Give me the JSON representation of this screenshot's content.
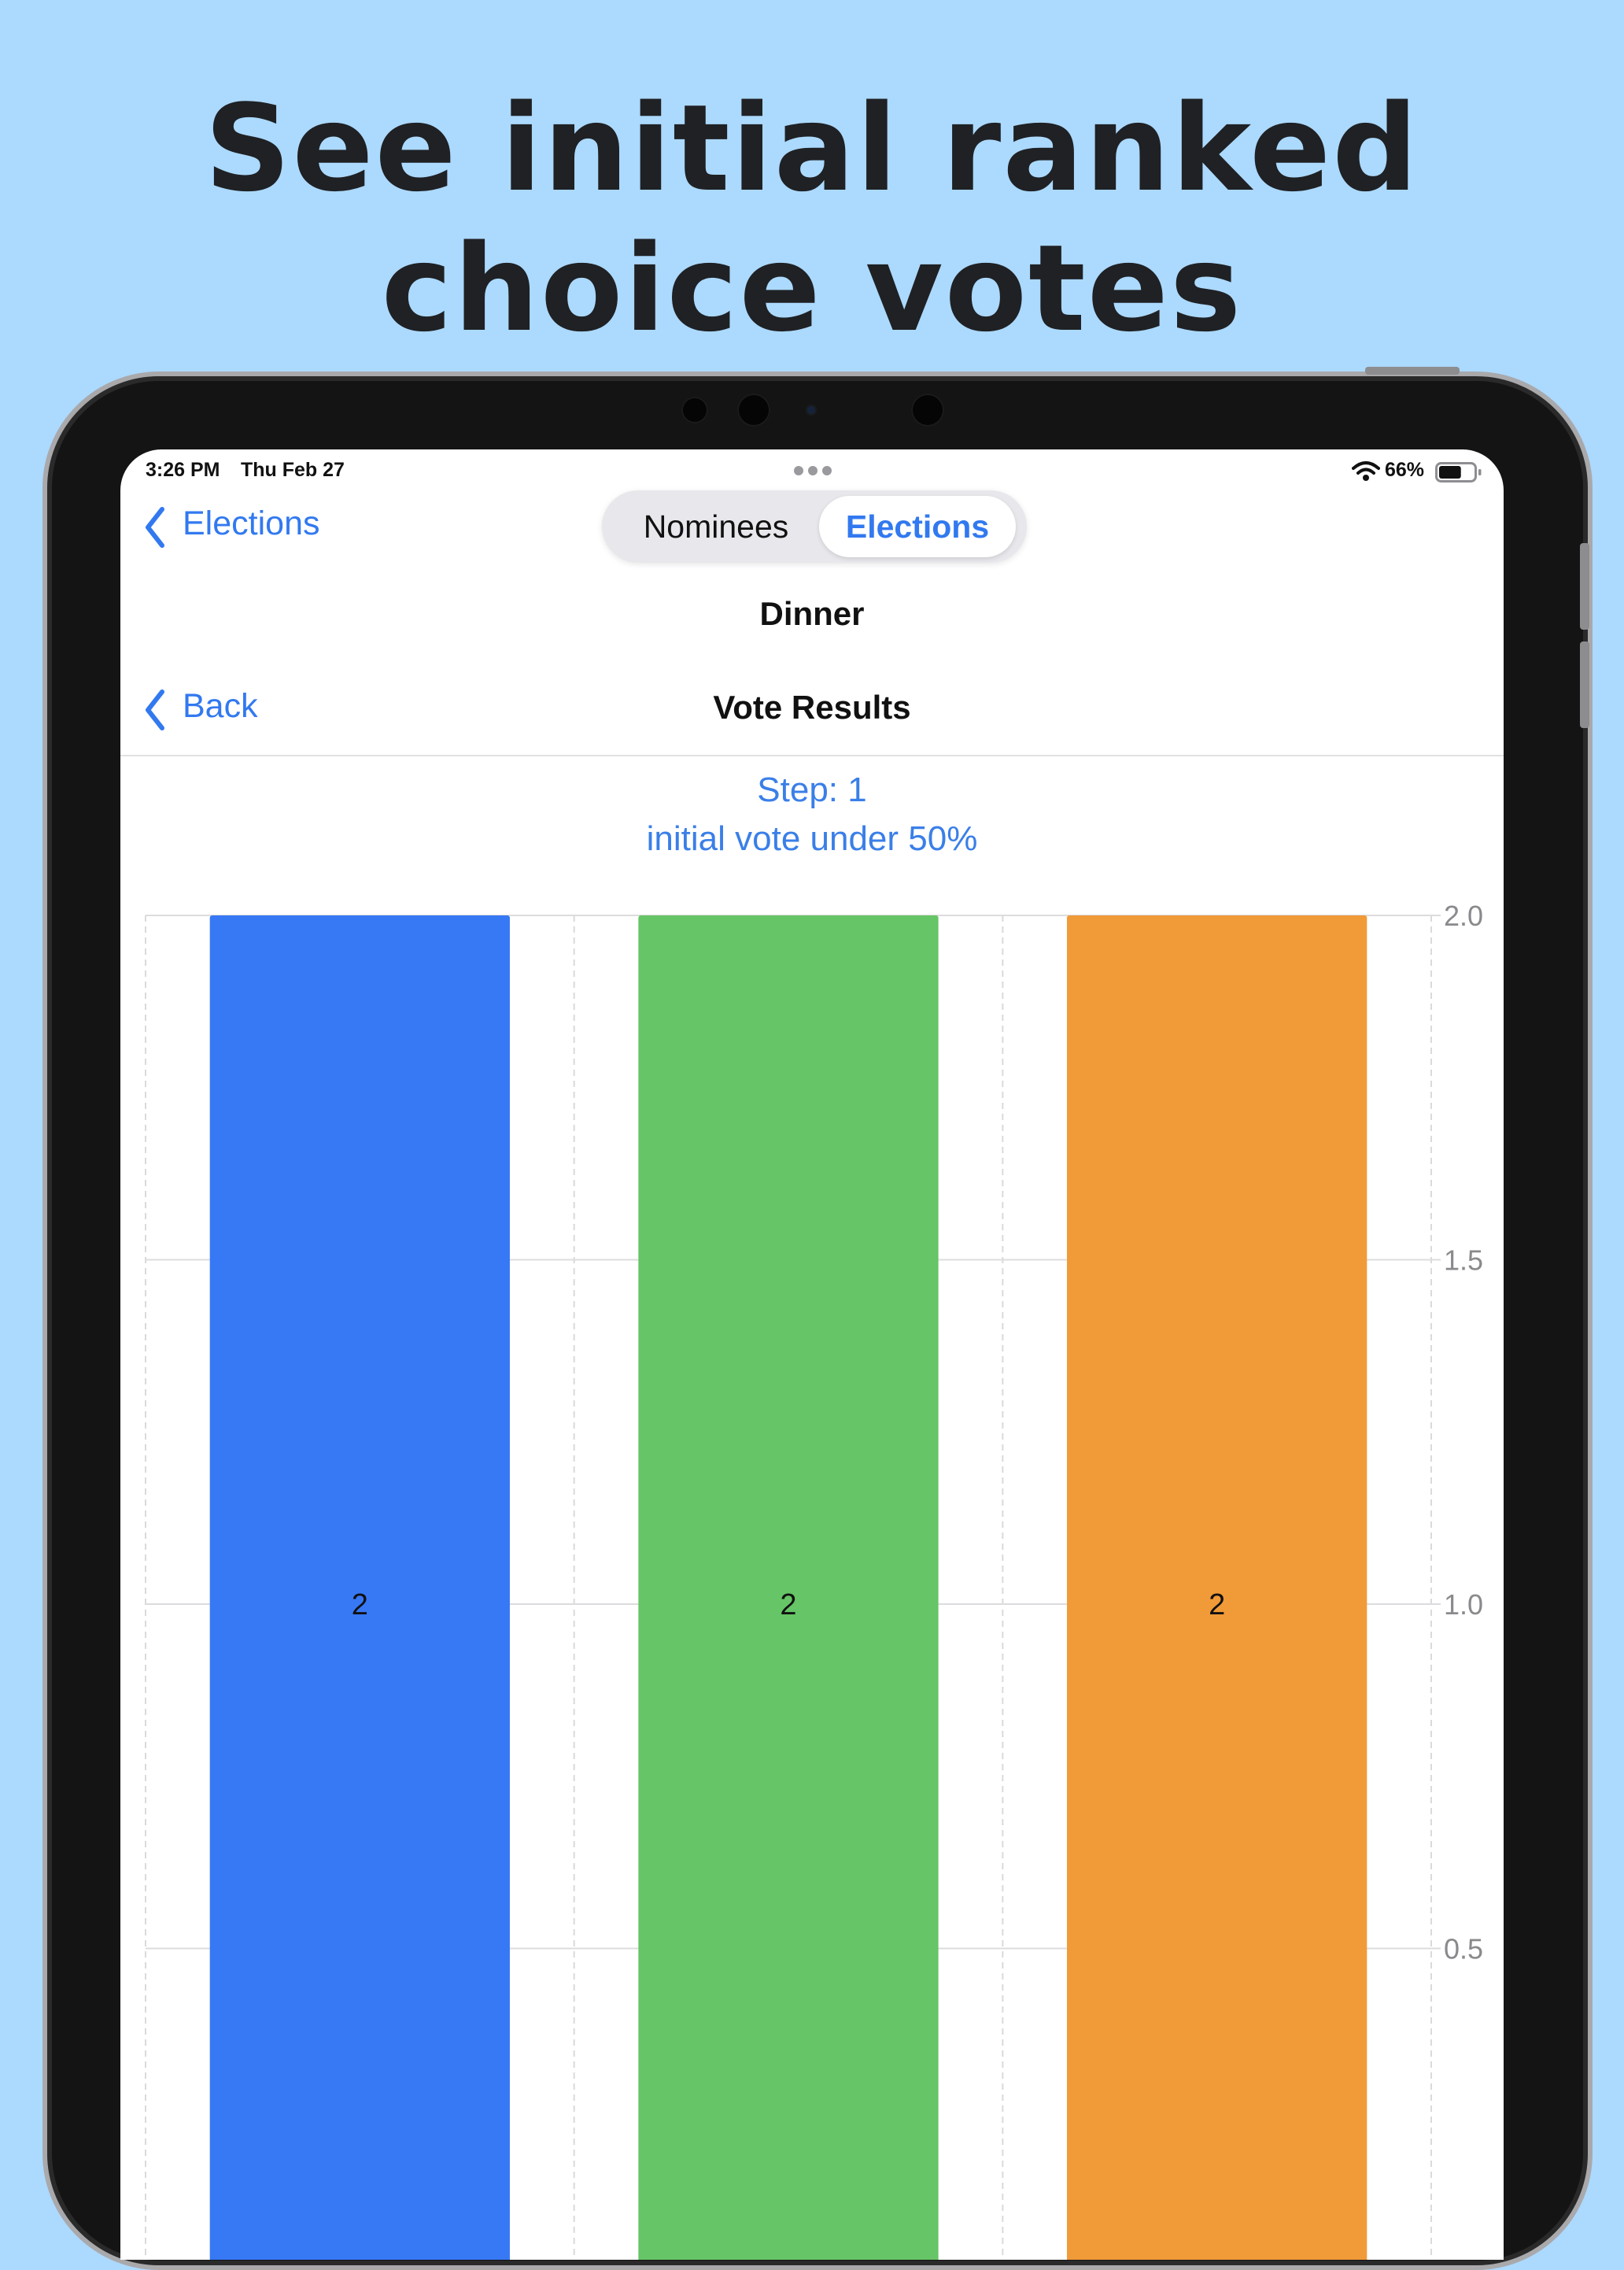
{
  "headline": {
    "line1": "See initial ranked",
    "line2": "choice votes"
  },
  "status_bar": {
    "time": "3:26 PM",
    "date": "Thu Feb 27",
    "battery_percent": "66%",
    "battery_level": 0.66,
    "icons": [
      "wifi-icon",
      "battery-icon",
      "multitasking-dots-icon"
    ]
  },
  "nav": {
    "back_label": "Elections",
    "segments": [
      "Nominees",
      "Elections"
    ],
    "selected_segment": "Elections",
    "title": "Dinner"
  },
  "subnav": {
    "back_label": "Back",
    "title": "Vote Results"
  },
  "result": {
    "step_text": "Step: 1",
    "status_text": "initial vote under 50%"
  },
  "colors": {
    "accent": "#3279f0",
    "background": "#acd9fe"
  },
  "chart_data": {
    "type": "bar",
    "title": "",
    "xlabel": "",
    "ylabel": "",
    "categories": [
      "",
      "",
      ""
    ],
    "values": [
      2,
      2,
      2
    ],
    "data_labels": [
      "2",
      "2",
      "2"
    ],
    "colors": [
      "#3778f5",
      "#66c566",
      "#f19a38"
    ],
    "ylim": [
      0,
      2.0
    ],
    "yticks": [
      "0",
      "0.5",
      "1.0",
      "1.5",
      "2.0"
    ],
    "y_axis_side": "right",
    "grid": true
  }
}
